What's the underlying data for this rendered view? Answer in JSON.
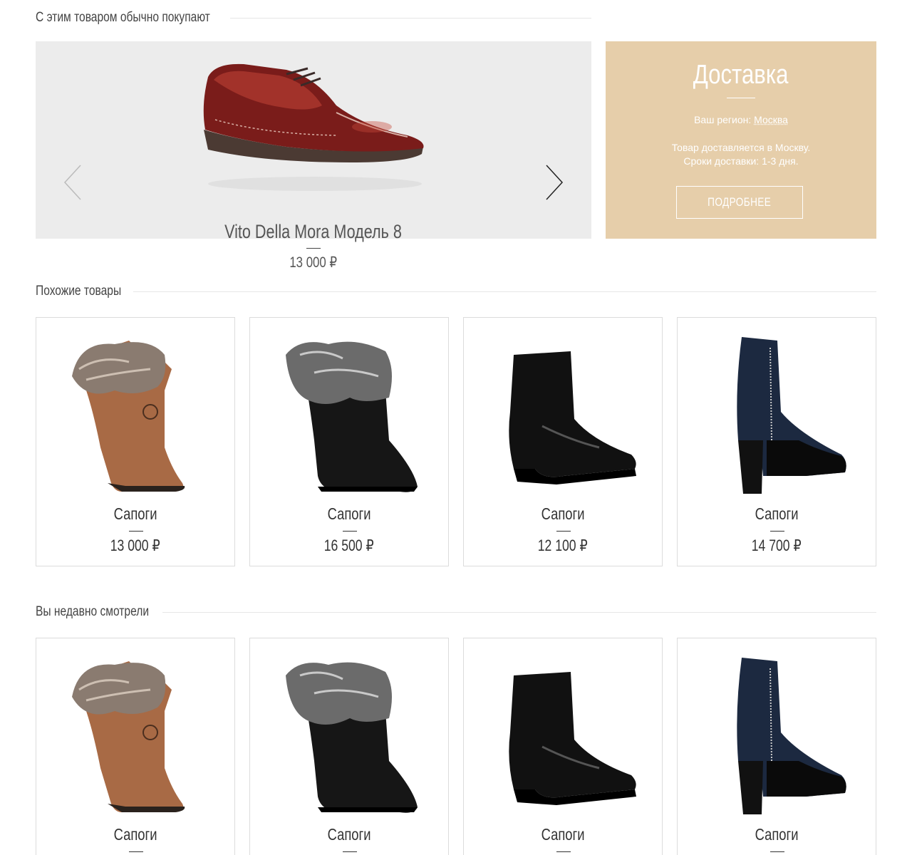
{
  "bought_together": {
    "title": "С этим товаром обычно покупают",
    "product": {
      "name": "Vito Della Mora Модель 8",
      "price": "13 000 ₽"
    }
  },
  "delivery": {
    "title": "Доставка",
    "region_label": "Ваш регион:",
    "region_value": "Москва",
    "info_line1": "Товар доставляется в Москву.",
    "info_line2": "Сроки доставки: 1-3 дня.",
    "more_button": "ПОДРОБНЕЕ"
  },
  "similar": {
    "title": "Похожие товары",
    "items": [
      {
        "name": "Сапоги",
        "price": "13 000 ₽"
      },
      {
        "name": "Сапоги",
        "price": "16 500 ₽"
      },
      {
        "name": "Сапоги",
        "price": "12 100 ₽"
      },
      {
        "name": "Сапоги",
        "price": "14 700 ₽"
      }
    ]
  },
  "recent": {
    "title": "Вы недавно смотрели",
    "items": [
      {
        "name": "Сапоги"
      },
      {
        "name": "Сапоги"
      },
      {
        "name": "Сапоги"
      },
      {
        "name": "Сапоги"
      }
    ]
  },
  "icons": {
    "prev": "chevron-left-icon",
    "next": "chevron-right-icon"
  },
  "colors": {
    "delivery_bg": "#e6ceaa",
    "carousel_bg": "#ececec"
  }
}
